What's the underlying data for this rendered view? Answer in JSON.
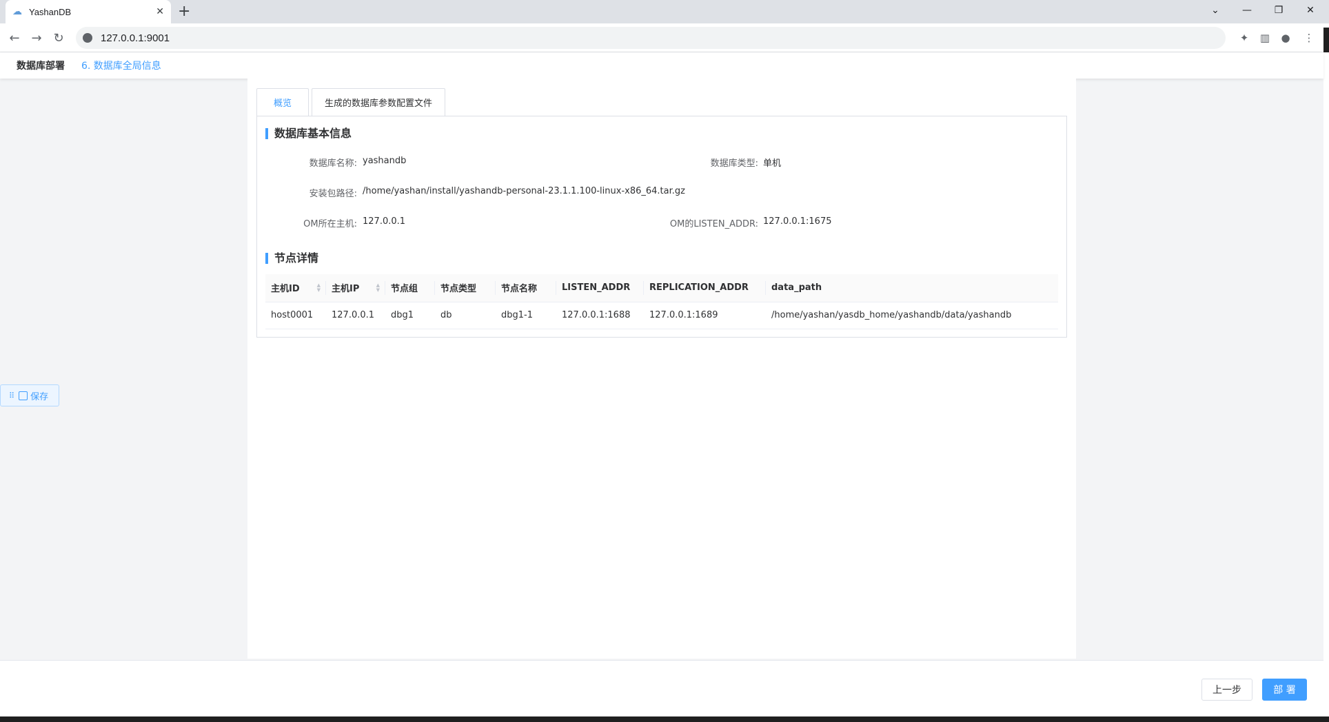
{
  "browser": {
    "tab_title": "YashanDB",
    "url": "127.0.0.1:9001"
  },
  "header": {
    "title": "数据库部署",
    "step": "6. 数据库全局信息"
  },
  "tabs": [
    {
      "label": "概览",
      "active": true
    },
    {
      "label": "生成的数据库参数配置文件",
      "active": false
    }
  ],
  "basic_info": {
    "section_title": "数据库基本信息",
    "db_name_label": "数据库名称:",
    "db_name": "yashandb",
    "db_type_label": "数据库类型:",
    "db_type": "单机",
    "install_path_label": "安装包路径:",
    "install_path": "/home/yashan/install/yashandb-personal-23.1.1.100-linux-x86_64.tar.gz",
    "om_host_label": "OM所在主机:",
    "om_host": "127.0.0.1",
    "om_listen_label": "OM的LISTEN_ADDR:",
    "om_listen": "127.0.0.1:1675"
  },
  "nodes": {
    "section_title": "节点详情",
    "columns": [
      "主机ID",
      "主机IP",
      "节点组",
      "节点类型",
      "节点名称",
      "LISTEN_ADDR",
      "REPLICATION_ADDR",
      "data_path"
    ],
    "rows": [
      [
        "host0001",
        "127.0.0.1",
        "dbg1",
        "db",
        "dbg1-1",
        "127.0.0.1:1688",
        "127.0.0.1:1689",
        "/home/yashan/yasdb_home/yashandb/data/yashandb"
      ]
    ]
  },
  "save_label": "保存",
  "footer": {
    "prev_label": "上一步",
    "deploy_label": "部 署"
  },
  "colors": {
    "accent": "#409eff"
  }
}
